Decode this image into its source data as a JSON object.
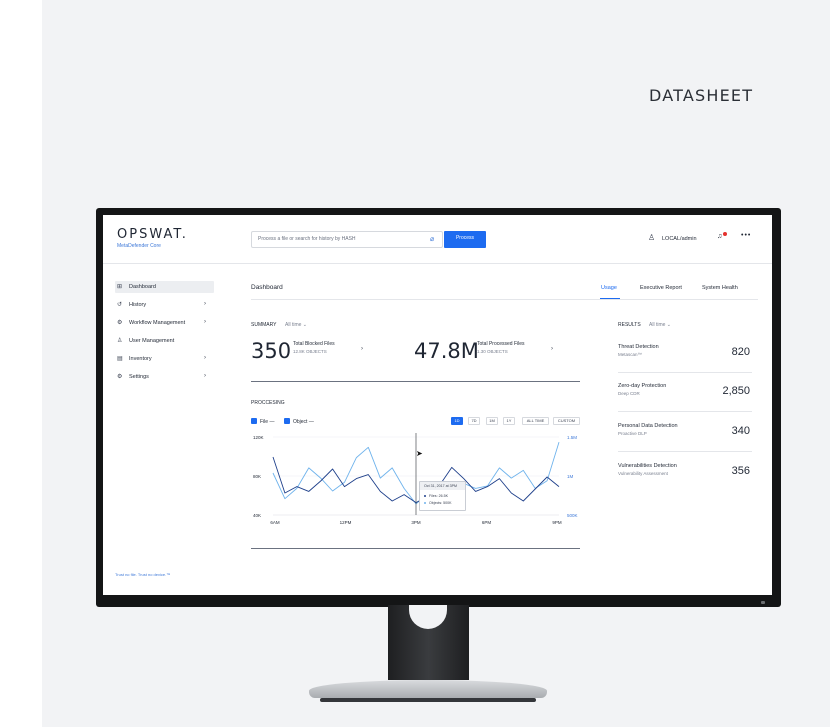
{
  "datasheet_label": "DATASHEET",
  "app": {
    "logo": "OPSWAT.",
    "product": "MetaDefender Core",
    "search_placeholder": "Process a file or search for history by HASH",
    "process_button": "Process",
    "user": "LOCAL/admin",
    "more": "•••"
  },
  "sidebar": {
    "items": [
      {
        "icon": "dashboard-icon",
        "glyph": "⊞",
        "label": "Dashboard",
        "chevron": ""
      },
      {
        "icon": "history-icon",
        "glyph": "↺",
        "label": "History",
        "chevron": "›"
      },
      {
        "icon": "workflow-icon",
        "glyph": "⚙",
        "label": "Workflow Management",
        "chevron": "›"
      },
      {
        "icon": "users-icon",
        "glyph": "♙",
        "label": "User Management",
        "chevron": ""
      },
      {
        "icon": "inventory-icon",
        "glyph": "▤",
        "label": "Inventory",
        "chevron": "›"
      },
      {
        "icon": "settings-icon",
        "glyph": "⚙",
        "label": "Settings",
        "chevron": "›"
      }
    ],
    "footer": "Trust no file. Trust no device.™"
  },
  "main": {
    "title": "Dashboard",
    "tabs": [
      "Usage",
      "Executive Report",
      "System Health"
    ],
    "summary_label": "SUMMARY",
    "summary_filter": "All time ⌄",
    "blocked": {
      "value": "350",
      "title": "Total Blocked Files",
      "sub": "12.8K OBJECTS"
    },
    "processed": {
      "value": "47.8M",
      "title": "Total Processed Files",
      "sub": "1.30 OBJECTS"
    },
    "processing_label": "PROCCESING",
    "legend": {
      "file": "File —",
      "object": "Object —"
    },
    "ranges": [
      "1D",
      "7D",
      "1M",
      "1Y",
      "ALL TIME",
      "CUSTOM"
    ],
    "tooltip": {
      "date": "Oct 31, 2017 at 3PM",
      "files": "Files:  26.5K",
      "objects": "Objects:  500K"
    }
  },
  "chart_data": {
    "type": "line",
    "x": [
      "6AM",
      "",
      "",
      "",
      "",
      "",
      "12PM",
      "",
      "",
      "",
      "",
      "",
      "3PM",
      "",
      "",
      "",
      "",
      "",
      "6PM",
      "",
      "",
      "",
      "",
      "",
      "9PM"
    ],
    "left_ticks": [
      "120K",
      "80K",
      "40K"
    ],
    "right_ticks": [
      "1.5M",
      "1M",
      "500K"
    ],
    "x_ticks": [
      "6AM",
      "12PM",
      "3PM",
      "6PM",
      "9PM"
    ],
    "series": [
      {
        "name": "File",
        "color": "#1e3f8a",
        "axis": "left",
        "values": [
          85,
          40,
          48,
          42,
          55,
          70,
          48,
          58,
          63,
          42,
          30,
          38,
          28,
          36,
          50,
          72,
          58,
          42,
          48,
          58,
          40,
          30,
          45,
          60,
          48
        ]
      },
      {
        "name": "Object",
        "color": "#6fb3ec",
        "axis": "right",
        "values": [
          0.8,
          0.3,
          0.5,
          0.9,
          0.7,
          0.45,
          0.62,
          1.1,
          1.3,
          0.7,
          0.9,
          0.5,
          0.2,
          0.4,
          0.3,
          0.2,
          0.6,
          0.5,
          0.55,
          0.9,
          0.7,
          0.85,
          0.5,
          0.65,
          1.4
        ]
      }
    ]
  },
  "results": {
    "label": "RESULTS",
    "filter": "All time ⌄",
    "items": [
      {
        "title": "Threat Detection",
        "sub": "Metascan™",
        "value": "820"
      },
      {
        "title": "Zero-day Protection",
        "sub": "Deep CDR",
        "value": "2,850"
      },
      {
        "title": "Personal Data Detection",
        "sub": "Proactive DLP",
        "value": "340"
      },
      {
        "title": "Vulnerabilities Detection",
        "sub": "Vulnerability Assessment",
        "value": "356"
      }
    ]
  }
}
